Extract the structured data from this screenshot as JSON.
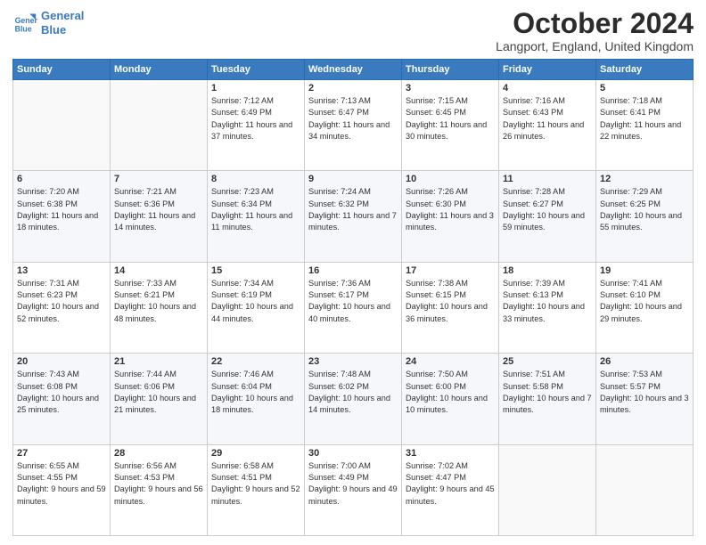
{
  "header": {
    "logo_line1": "General",
    "logo_line2": "Blue",
    "month": "October 2024",
    "location": "Langport, England, United Kingdom"
  },
  "days_of_week": [
    "Sunday",
    "Monday",
    "Tuesday",
    "Wednesday",
    "Thursday",
    "Friday",
    "Saturday"
  ],
  "weeks": [
    [
      {
        "day": "",
        "info": ""
      },
      {
        "day": "",
        "info": ""
      },
      {
        "day": "1",
        "info": "Sunrise: 7:12 AM\nSunset: 6:49 PM\nDaylight: 11 hours and 37 minutes."
      },
      {
        "day": "2",
        "info": "Sunrise: 7:13 AM\nSunset: 6:47 PM\nDaylight: 11 hours and 34 minutes."
      },
      {
        "day": "3",
        "info": "Sunrise: 7:15 AM\nSunset: 6:45 PM\nDaylight: 11 hours and 30 minutes."
      },
      {
        "day": "4",
        "info": "Sunrise: 7:16 AM\nSunset: 6:43 PM\nDaylight: 11 hours and 26 minutes."
      },
      {
        "day": "5",
        "info": "Sunrise: 7:18 AM\nSunset: 6:41 PM\nDaylight: 11 hours and 22 minutes."
      }
    ],
    [
      {
        "day": "6",
        "info": "Sunrise: 7:20 AM\nSunset: 6:38 PM\nDaylight: 11 hours and 18 minutes."
      },
      {
        "day": "7",
        "info": "Sunrise: 7:21 AM\nSunset: 6:36 PM\nDaylight: 11 hours and 14 minutes."
      },
      {
        "day": "8",
        "info": "Sunrise: 7:23 AM\nSunset: 6:34 PM\nDaylight: 11 hours and 11 minutes."
      },
      {
        "day": "9",
        "info": "Sunrise: 7:24 AM\nSunset: 6:32 PM\nDaylight: 11 hours and 7 minutes."
      },
      {
        "day": "10",
        "info": "Sunrise: 7:26 AM\nSunset: 6:30 PM\nDaylight: 11 hours and 3 minutes."
      },
      {
        "day": "11",
        "info": "Sunrise: 7:28 AM\nSunset: 6:27 PM\nDaylight: 10 hours and 59 minutes."
      },
      {
        "day": "12",
        "info": "Sunrise: 7:29 AM\nSunset: 6:25 PM\nDaylight: 10 hours and 55 minutes."
      }
    ],
    [
      {
        "day": "13",
        "info": "Sunrise: 7:31 AM\nSunset: 6:23 PM\nDaylight: 10 hours and 52 minutes."
      },
      {
        "day": "14",
        "info": "Sunrise: 7:33 AM\nSunset: 6:21 PM\nDaylight: 10 hours and 48 minutes."
      },
      {
        "day": "15",
        "info": "Sunrise: 7:34 AM\nSunset: 6:19 PM\nDaylight: 10 hours and 44 minutes."
      },
      {
        "day": "16",
        "info": "Sunrise: 7:36 AM\nSunset: 6:17 PM\nDaylight: 10 hours and 40 minutes."
      },
      {
        "day": "17",
        "info": "Sunrise: 7:38 AM\nSunset: 6:15 PM\nDaylight: 10 hours and 36 minutes."
      },
      {
        "day": "18",
        "info": "Sunrise: 7:39 AM\nSunset: 6:13 PM\nDaylight: 10 hours and 33 minutes."
      },
      {
        "day": "19",
        "info": "Sunrise: 7:41 AM\nSunset: 6:10 PM\nDaylight: 10 hours and 29 minutes."
      }
    ],
    [
      {
        "day": "20",
        "info": "Sunrise: 7:43 AM\nSunset: 6:08 PM\nDaylight: 10 hours and 25 minutes."
      },
      {
        "day": "21",
        "info": "Sunrise: 7:44 AM\nSunset: 6:06 PM\nDaylight: 10 hours and 21 minutes."
      },
      {
        "day": "22",
        "info": "Sunrise: 7:46 AM\nSunset: 6:04 PM\nDaylight: 10 hours and 18 minutes."
      },
      {
        "day": "23",
        "info": "Sunrise: 7:48 AM\nSunset: 6:02 PM\nDaylight: 10 hours and 14 minutes."
      },
      {
        "day": "24",
        "info": "Sunrise: 7:50 AM\nSunset: 6:00 PM\nDaylight: 10 hours and 10 minutes."
      },
      {
        "day": "25",
        "info": "Sunrise: 7:51 AM\nSunset: 5:58 PM\nDaylight: 10 hours and 7 minutes."
      },
      {
        "day": "26",
        "info": "Sunrise: 7:53 AM\nSunset: 5:57 PM\nDaylight: 10 hours and 3 minutes."
      }
    ],
    [
      {
        "day": "27",
        "info": "Sunrise: 6:55 AM\nSunset: 4:55 PM\nDaylight: 9 hours and 59 minutes."
      },
      {
        "day": "28",
        "info": "Sunrise: 6:56 AM\nSunset: 4:53 PM\nDaylight: 9 hours and 56 minutes."
      },
      {
        "day": "29",
        "info": "Sunrise: 6:58 AM\nSunset: 4:51 PM\nDaylight: 9 hours and 52 minutes."
      },
      {
        "day": "30",
        "info": "Sunrise: 7:00 AM\nSunset: 4:49 PM\nDaylight: 9 hours and 49 minutes."
      },
      {
        "day": "31",
        "info": "Sunrise: 7:02 AM\nSunset: 4:47 PM\nDaylight: 9 hours and 45 minutes."
      },
      {
        "day": "",
        "info": ""
      },
      {
        "day": "",
        "info": ""
      }
    ]
  ]
}
